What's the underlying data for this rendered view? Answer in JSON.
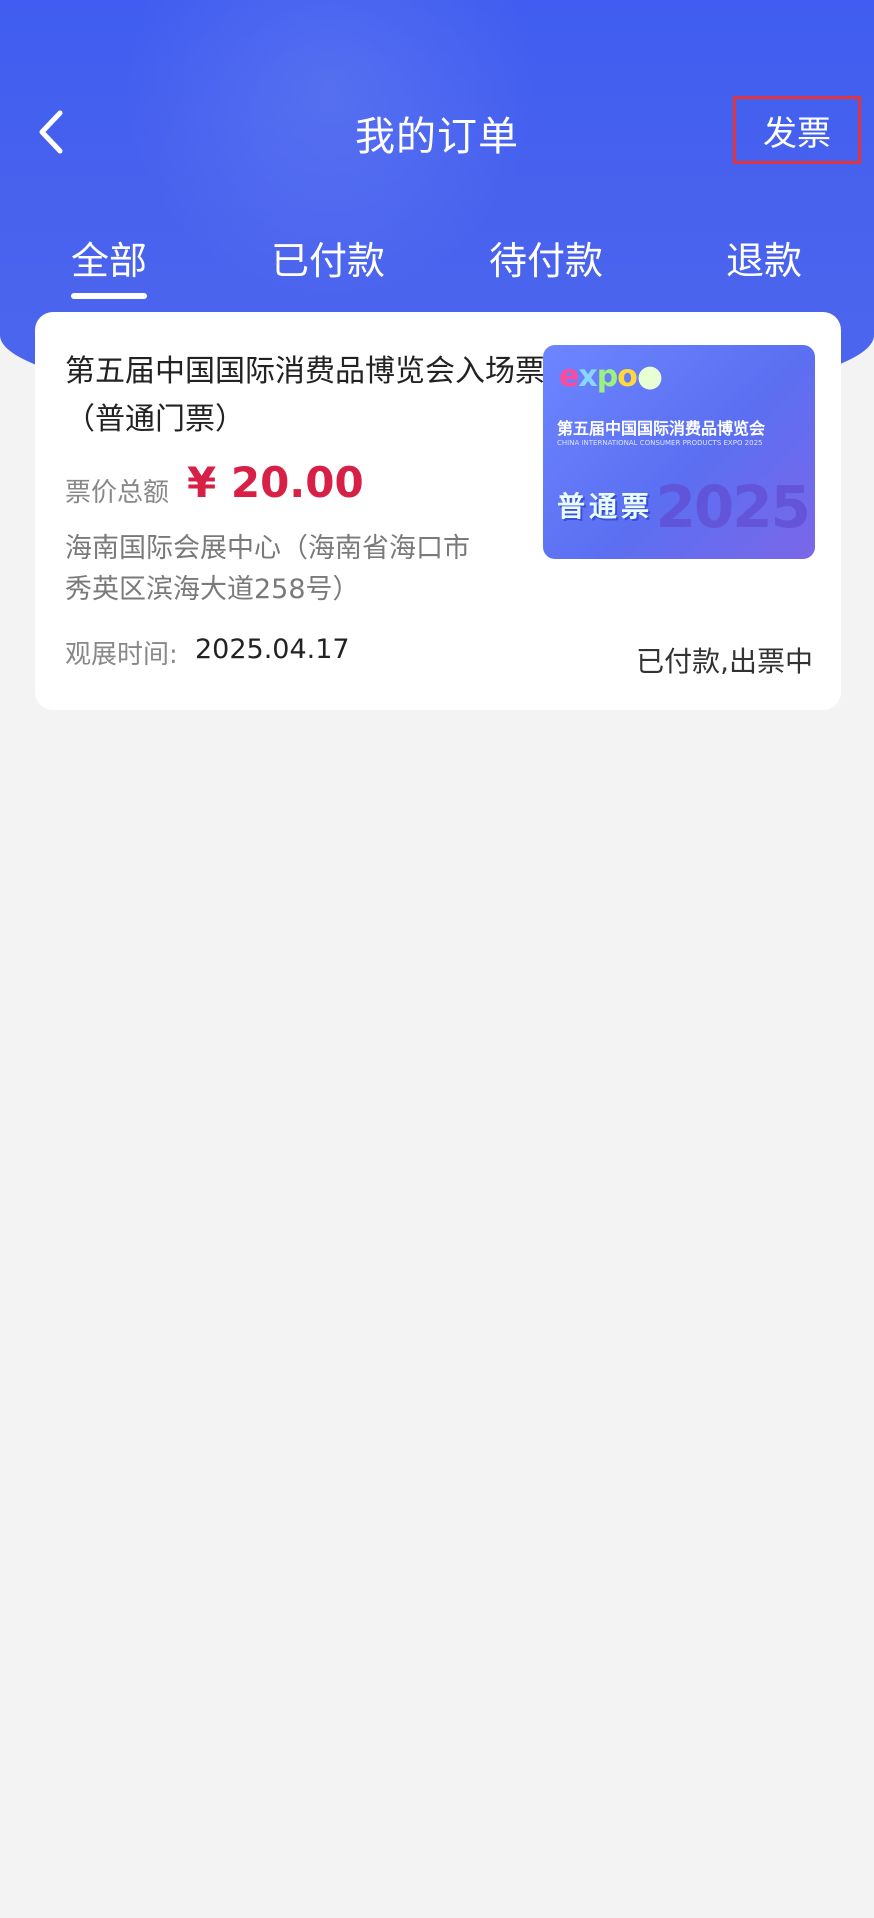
{
  "header": {
    "title": "我的订单",
    "invoice_label": "发票",
    "back_icon": "chevron-left-icon"
  },
  "tabs": [
    {
      "label": "全部",
      "active": true
    },
    {
      "label": "已付款",
      "active": false
    },
    {
      "label": "待付款",
      "active": false
    },
    {
      "label": "退款",
      "active": false
    }
  ],
  "order": {
    "title": "第五届中国国际消费品博览会入场票（普通门票）",
    "price_label": "票价总额",
    "price_value": "¥ 20.00",
    "venue": "海南国际会展中心（海南省海口市秀英区滨海大道258号）",
    "time_label": "观展时间:",
    "time_value": "2025.04.17",
    "status": "已付款,出票中",
    "image": {
      "title": "第五届中国国际消费品博览会",
      "subtitle": "CHINA INTERNATIONAL CONSUMER PRODUCTS EXPO 2025",
      "badge": "普通票",
      "year": "2025"
    }
  },
  "colors": {
    "header_blue": "#4a63ee",
    "price_red": "#d81f45",
    "highlight_red": "#e0343e",
    "background": "#f3f3f3"
  }
}
